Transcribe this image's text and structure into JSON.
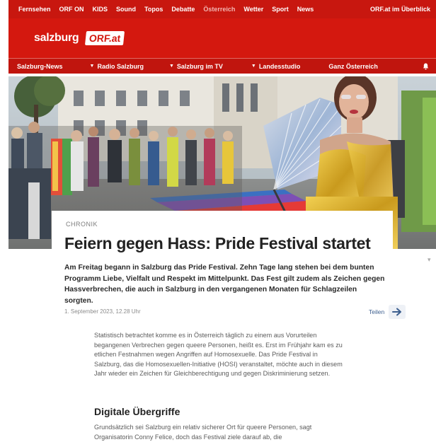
{
  "top_nav": {
    "items": [
      "Fernsehen",
      "ORF ON",
      "KIDS",
      "Sound",
      "Topos",
      "Debatte",
      "Österreich",
      "Wetter",
      "Sport",
      "News"
    ],
    "right_link": "ORF.at im Überblick"
  },
  "header": {
    "region": "salzburg",
    "brand": "ORF.at"
  },
  "sub_nav": {
    "items": [
      "Salzburg-News",
      "Radio Salzburg",
      "Salzburg im TV",
      "Landesstudio",
      "Ganz Österreich"
    ]
  },
  "article": {
    "category": "CHRONIK",
    "title": "Feiern gegen Hass: Pride Festival startet",
    "lead": "Am Freitag begann in Salzburg das Pride Festival. Zehn Tage lang stehen bei dem bunten Programm Liebe, Vielfalt und Respekt im Mittelpunkt. Das Fest gilt zudem als Zeichen gegen Hassverbrechen, die auch in Salzburg in den vergangenen Monaten für Schlagzeilen sorgten.",
    "date": "1. September 2023, 12.28 Uhr",
    "share_label": "Teilen",
    "body": "Statistisch betrachtet komme es in Österreich täglich zu einem aus Vorurteilen begangenen Verbrechen gegen queere Personen, heißt es. Erst im Frühjahr kam es zu etlichen Festnahmen wegen Angriffen auf Homosexuelle. Das Pride Festival in Salzburg, das die Homosexuellen-Initiative (HOSI) veranstaltet, möchte auch in diesem Jahr wieder ein Zeichen für Gleichberechtigung und gegen Diskriminierung setzen.",
    "subheading": "Digitale Übergriffe",
    "body2": "Grundsätzlich sei Salzburg ein relativ sicherer Ort für queere Personen, sagt Organisatorin Conny Felice, doch das Festival ziele darauf ab, die"
  },
  "icons": {
    "nav_chevron": "chevron-down-icon",
    "notification": "bell-icon",
    "share": "arrow-right-icon"
  },
  "colors": {
    "brand_red": "#d4180f",
    "nav_red": "#c8170f",
    "share_blue": "#3d5f8f"
  }
}
